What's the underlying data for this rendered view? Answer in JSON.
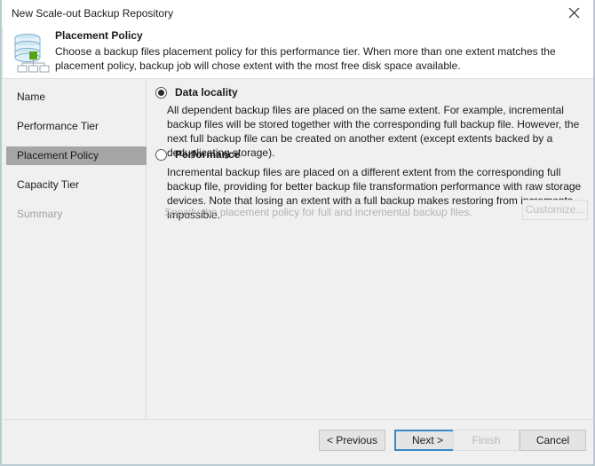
{
  "window": {
    "title": "New Scale-out Backup Repository",
    "close_icon": "close-icon"
  },
  "header": {
    "icon": "scale-out-repository-icon",
    "title": "Placement Policy",
    "description": "Choose a backup files placement policy for this performance tier. When more than one extent matches the placement policy, backup job will chose extent with the most free disk space available."
  },
  "sidebar": {
    "items": [
      {
        "label": "Name",
        "state": "normal"
      },
      {
        "label": "Performance Tier",
        "state": "normal"
      },
      {
        "label": "Placement Policy",
        "state": "selected"
      },
      {
        "label": "Capacity Tier",
        "state": "normal"
      },
      {
        "label": "Summary",
        "state": "disabled"
      }
    ]
  },
  "main": {
    "options": [
      {
        "label": "Data locality",
        "selected": true,
        "description": "All dependent backup files are placed on the same extent. For example, incremental backup files will be stored together with the corresponding full backup file. However, the next full backup file can be created on another extent (except extents backed by a deduplicating storage)."
      },
      {
        "label": "Performance",
        "selected": false,
        "description": "Incremental backup files are placed on a different extent from the corresponding full backup file, providing for better backup file transformation performance with raw storage devices. Note that losing an extent with a full backup makes restoring from increments impossible."
      }
    ],
    "hint": "Specify the placement policy for full and incremental backup files.",
    "customize_label": "Customize..."
  },
  "footer": {
    "previous_label": "< Previous",
    "next_label": "Next >",
    "finish_label": "Finish",
    "cancel_label": "Cancel"
  },
  "colors": {
    "accent": "#3d88c4",
    "selection": "#a6a6a6",
    "dialog_border": "#b9cbd1",
    "icon_green": "#57a318"
  }
}
